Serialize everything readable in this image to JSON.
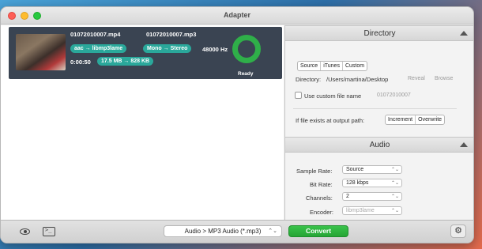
{
  "window": {
    "title": "Adapter"
  },
  "job": {
    "source_file": "01072010007.mp4",
    "output_file": "01072010007.mp3",
    "codec_from": "aac",
    "codec_to": "libmp3lame",
    "channels_from": "Mono",
    "channels_to": "Stereo",
    "sample_rate": "48000 Hz",
    "duration": "0:00:50",
    "size_from": "17.5 MB",
    "size_to": "828 KB",
    "arrow": "→",
    "status": "Ready"
  },
  "directory": {
    "header": "Directory",
    "tabs": [
      "Source",
      "iTunes",
      "Custom"
    ],
    "path_label": "Directory:",
    "path_value": "/Users/martina/Desktop",
    "reveal_label": "Reveal",
    "browse_label": "Browse",
    "custom_name_label": "Use custom file name",
    "custom_name_placeholder": "01072010007",
    "exists_label": "If file exists at output path:",
    "exists_options": [
      "Increment",
      "Overwrite"
    ]
  },
  "audio": {
    "header": "Audio",
    "sample_rate_label": "Sample Rate:",
    "sample_rate_value": "Source",
    "bit_rate_label": "Bit Rate:",
    "bit_rate_value": "128 kbps",
    "channels_label": "Channels:",
    "channels_value": "2",
    "encoder_label": "Encoder:",
    "encoder_value": "libmp3lame"
  },
  "bottom": {
    "format_value": "Audio > MP3 Audio (*.mp3)",
    "convert_label": "Convert"
  },
  "icons": {
    "chevron": "⌃⌄",
    "gear": "⚙",
    "terminal_prompt": ">_"
  },
  "colors": {
    "accent_teal": "#2aa89b",
    "ring_green": "#2faf49",
    "convert_green": "#2db23d"
  }
}
